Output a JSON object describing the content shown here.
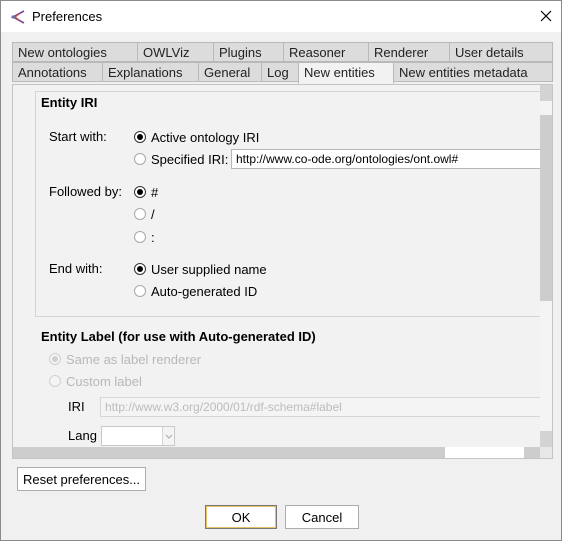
{
  "window": {
    "title": "Preferences",
    "app_icon": "protege-icon",
    "close_icon": "close-icon"
  },
  "tabs": {
    "row1": [
      "New ontologies",
      "OWLViz",
      "Plugins",
      "Reasoner",
      "Renderer",
      "User details"
    ],
    "row2": [
      "Annotations",
      "Explanations",
      "General",
      "Log",
      "New entities",
      "New entities metadata"
    ],
    "active": "New entities"
  },
  "entity_iri": {
    "title": "Entity IRI",
    "start_with": {
      "label": "Start with:",
      "options": [
        "Active ontology IRI",
        "Specified IRI:"
      ],
      "selected": "Active ontology IRI",
      "specified_iri_value": "http://www.co-ode.org/ontologies/ont.owl#"
    },
    "followed_by": {
      "label": "Followed by:",
      "options": [
        "#",
        "/",
        ":"
      ],
      "selected": "#"
    },
    "end_with": {
      "label": "End with:",
      "options": [
        "User supplied name",
        "Auto-generated ID"
      ],
      "selected": "User supplied name"
    }
  },
  "entity_label": {
    "title": "Entity Label (for use with Auto-generated ID)",
    "options": [
      "Same as label renderer",
      "Custom label"
    ],
    "selected": "Same as label renderer",
    "iri_label": "IRI",
    "iri_value": "http://www.w3.org/2000/01/rdf-schema#label",
    "lang_label": "Lang",
    "lang_value": ""
  },
  "buttons": {
    "reset": "Reset preferences...",
    "ok": "OK",
    "cancel": "Cancel"
  }
}
